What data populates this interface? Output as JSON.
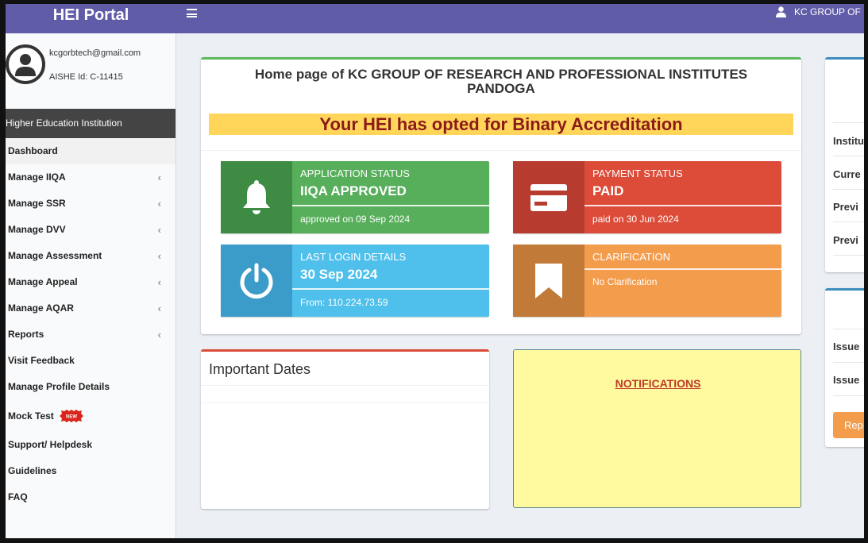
{
  "header": {
    "logo": "HEI Portal",
    "user_name": "KC GROUP OF"
  },
  "sidebar": {
    "email": "kcgorbtech@gmail.com",
    "aishe": "AISHE Id: C-11415",
    "section_header": "Higher Education Institution",
    "items": [
      {
        "label": "Dashboard",
        "has_chevron": false
      },
      {
        "label": "Manage IIQA",
        "has_chevron": true
      },
      {
        "label": "Manage SSR",
        "has_chevron": true
      },
      {
        "label": "Manage DVV",
        "has_chevron": true
      },
      {
        "label": "Manage Assessment",
        "has_chevron": true
      },
      {
        "label": "Manage Appeal",
        "has_chevron": true
      },
      {
        "label": "Manage AQAR",
        "has_chevron": true
      },
      {
        "label": "Reports",
        "has_chevron": true
      },
      {
        "label": "Visit Feedback",
        "has_chevron": false
      },
      {
        "label": "Manage Profile Details",
        "has_chevron": false
      },
      {
        "label": "Mock Test",
        "has_chevron": false,
        "badge": "NEW"
      },
      {
        "label": "Support/ Helpdesk",
        "has_chevron": false
      },
      {
        "label": "Guidelines",
        "has_chevron": false
      },
      {
        "label": "FAQ",
        "has_chevron": false
      }
    ],
    "chevron": "‹"
  },
  "main": {
    "title_line1": "Home page of KC GROUP OF RESEARCH AND PROFESSIONAL INSTITUTES",
    "title_line2": "PANDOGA",
    "banner": "Your HEI has opted for Binary Accreditation",
    "info_boxes": {
      "application": {
        "label": "APPLICATION STATUS",
        "value": "IIQA APPROVED",
        "desc": "approved on 09 Sep 2024",
        "icon": "bell-icon"
      },
      "payment": {
        "label": "PAYMENT STATUS",
        "value": "PAID",
        "desc": "paid on 30 Jun 2024",
        "icon": "credit-card-icon"
      },
      "login": {
        "label": "LAST LOGIN DETAILS",
        "value": "30 Sep 2024",
        "desc": "From: 110.224.73.59",
        "icon": "power-icon"
      },
      "clarification": {
        "label": "CLARIFICATION",
        "desc": "No Clarification",
        "icon": "bookmark-icon"
      }
    },
    "important_dates": {
      "title": "Important Dates"
    },
    "notifications": {
      "title": "NOTIFICATIONS"
    }
  },
  "right_panel": {
    "box1_items": [
      "Institu",
      "Curre",
      "Previ",
      "Previ"
    ],
    "box2_items": [
      "Issue",
      "Issue"
    ],
    "button": "Rep"
  },
  "colors": {
    "header": "#605ca8",
    "application": "#57ae5b",
    "payment": "#dd4b39",
    "login": "#4fc0eb",
    "clarification": "#f39c4c",
    "banner_bg": "#ffd65a",
    "banner_text": "#8b1a1a",
    "notifications_bg": "#fffa9f"
  }
}
